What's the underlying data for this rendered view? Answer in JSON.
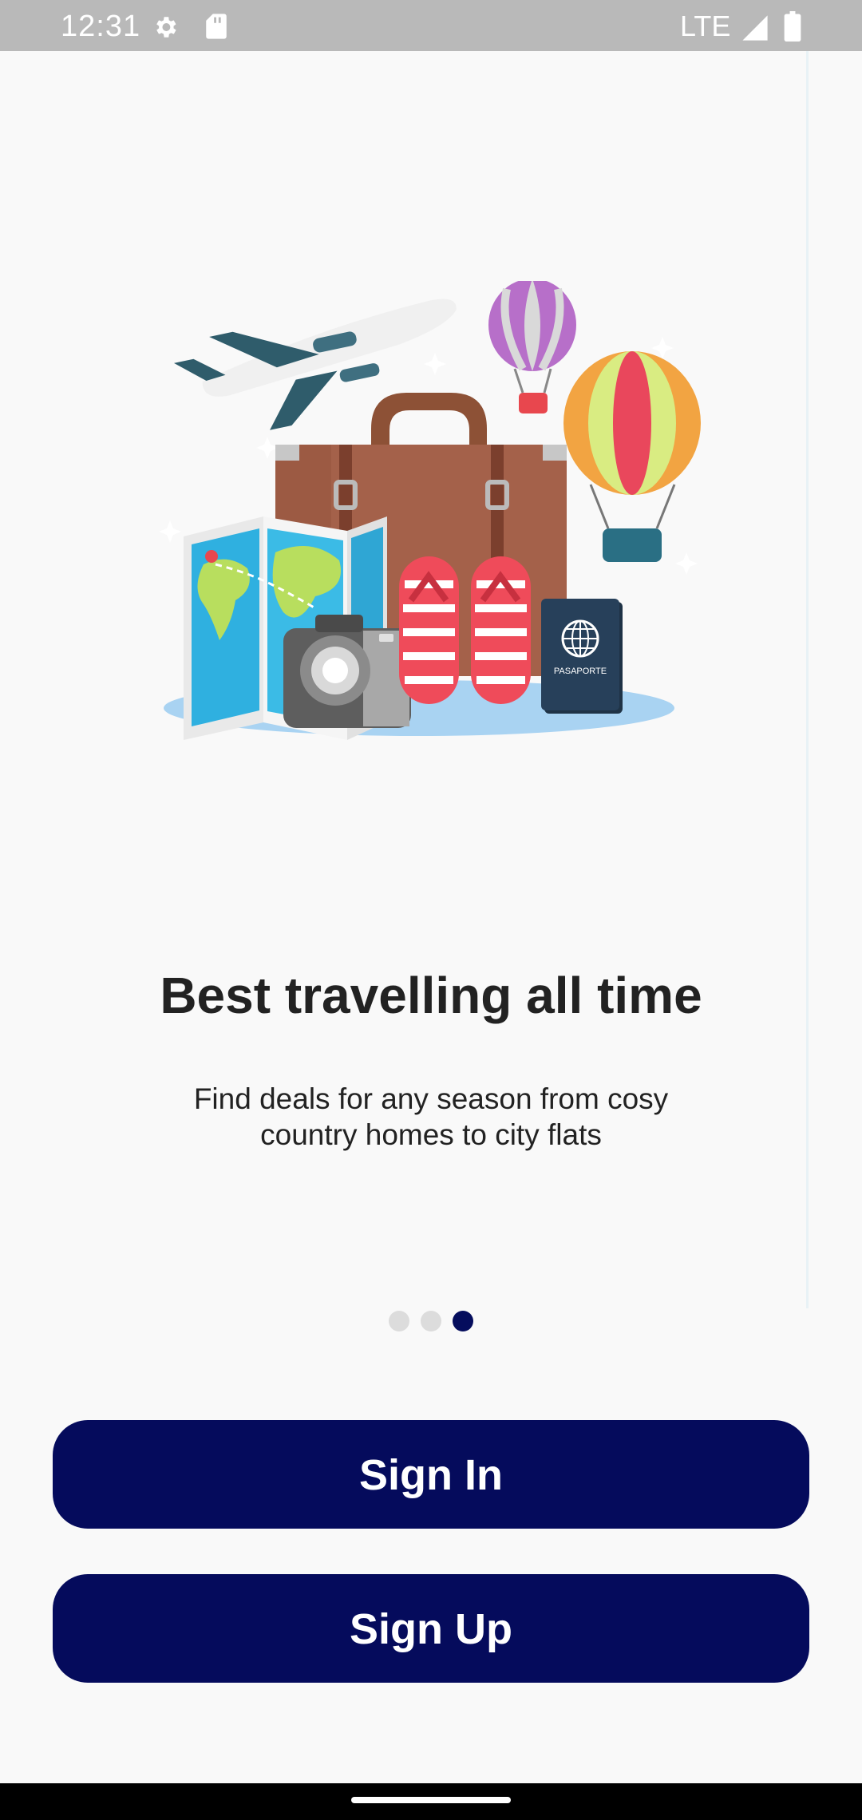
{
  "status_bar": {
    "time": "12:31",
    "network": "LTE",
    "icons": [
      "gear-icon",
      "sd-card-icon",
      "signal-icon",
      "battery-icon"
    ]
  },
  "onboarding": {
    "illustration": "travel-illustration",
    "title": "Best travelling all time",
    "subtitle": "Find deals for any season from cosy country homes to city flats",
    "page_indicator": {
      "count": 3,
      "active_index": 2
    }
  },
  "actions": {
    "sign_in_label": "Sign In",
    "sign_up_label": "Sign Up"
  },
  "colors": {
    "primary": "#050b5c",
    "background": "#f9f9f9",
    "status_bar": "#b9b9b9",
    "dot_inactive": "#dcdcdc"
  }
}
